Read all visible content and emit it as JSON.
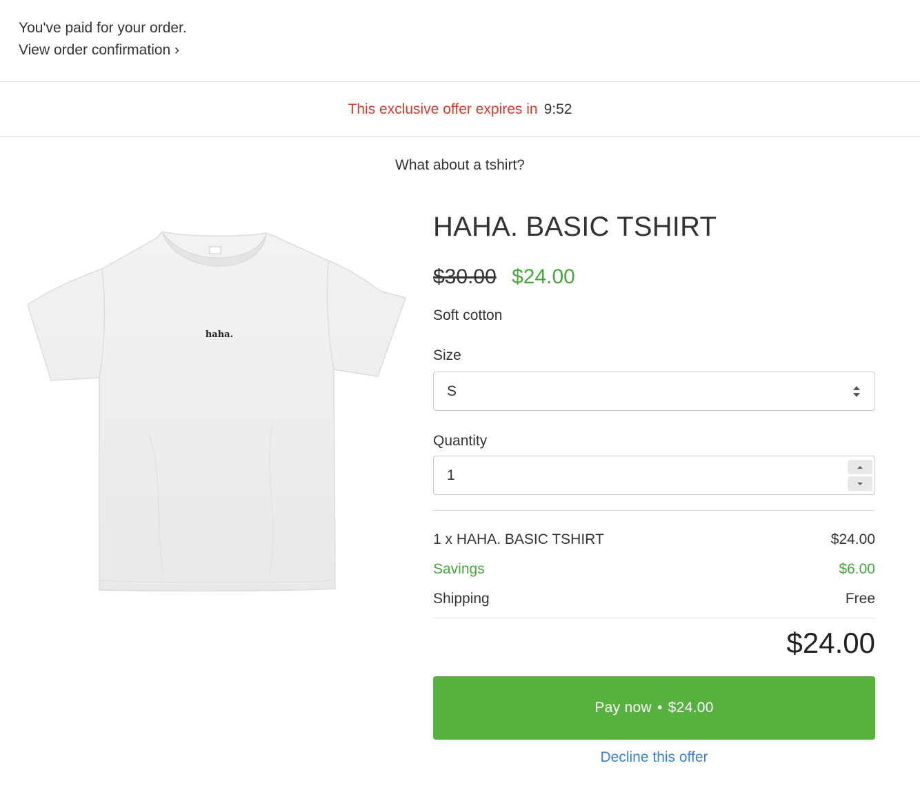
{
  "banner": {
    "paid_text": "You've paid for your order.",
    "confirmation_link": "View order confirmation ›"
  },
  "timer": {
    "label": "This exclusive offer expires in",
    "value": "9:52",
    "label_color": "#d93a2b"
  },
  "offer": {
    "heading": "What about a tshirt?"
  },
  "product": {
    "image_icon": "tshirt-image",
    "image_print": "haha.",
    "title": "HAHA. BASIC TSHIRT",
    "price_original": "$30.00",
    "price_sale": "$24.00",
    "description": "Soft cotton"
  },
  "size": {
    "label": "Size",
    "selected": "S"
  },
  "quantity": {
    "label": "Quantity",
    "value": "1"
  },
  "summary": {
    "line_item_label": "1 x HAHA. BASIC TSHIRT",
    "line_item_value": "$24.00",
    "savings_label": "Savings",
    "savings_value": "$6.00",
    "shipping_label": "Shipping",
    "shipping_value": "Free",
    "total": "$24.00"
  },
  "actions": {
    "pay_label": "Pay now",
    "pay_separator": "•",
    "pay_amount": "$24.00",
    "decline_label": "Decline this offer"
  },
  "colors": {
    "accent_green": "#56b13f",
    "sale_green": "#44a83a",
    "link_blue": "#3b7dd8"
  }
}
